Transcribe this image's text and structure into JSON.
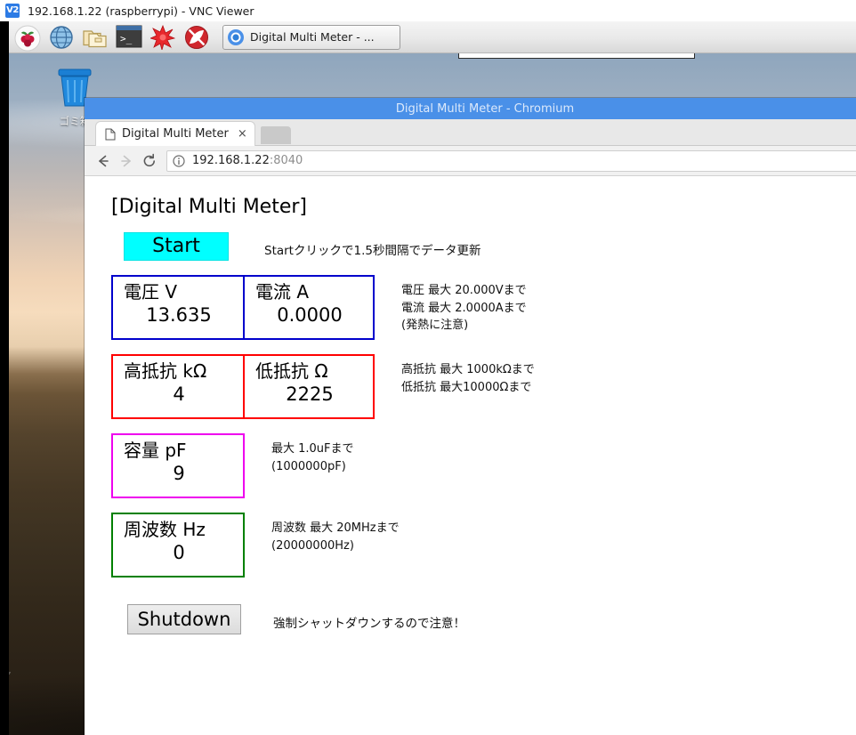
{
  "vnc": {
    "icon": "vnc-viewer-icon",
    "icon_text": "V2",
    "title": "192.168.1.22 (raspberrypi) - VNC Viewer"
  },
  "taskbar": {
    "icons": [
      {
        "name": "raspberry-menu-icon",
        "title": "Menu"
      },
      {
        "name": "globe-browser-icon",
        "title": "Web Browser"
      },
      {
        "name": "folder-file-manager-icon",
        "title": "File Manager"
      },
      {
        "name": "terminal-icon",
        "title": "Terminal"
      },
      {
        "name": "mathematica-star-icon",
        "title": "Mathematica"
      },
      {
        "name": "wolfram-icon",
        "title": "Wolfram"
      }
    ],
    "window_button_label": "Digital Multi Meter - ..."
  },
  "desktop": {
    "trash_label": "ゴミ箱"
  },
  "browser": {
    "window_title": "Digital Multi Meter - Chromium",
    "tab_title": "Digital Multi Meter",
    "tab_close": "×",
    "url_host": "192.168.1.22",
    "url_port": ":8040",
    "back_icon": "back-arrow-icon",
    "forward_icon": "forward-arrow-icon",
    "reload_icon": "reload-icon",
    "info_icon": "page-info-icon"
  },
  "app": {
    "title": "[Digital Multi Meter]",
    "start_button": "Start",
    "start_note": "Startクリックで1.5秒間隔でデータ更新",
    "shutdown_button": "Shutdown",
    "shutdown_note": "強制シャットダウンするので注意！",
    "groups": [
      {
        "id": "voltage-current",
        "color": "#0000cc",
        "cells": [
          {
            "id": "voltage",
            "label": "電圧 V",
            "value": "13.635"
          },
          {
            "id": "current",
            "label": "電流 A",
            "value": "0.0000"
          }
        ],
        "note": "電圧 最大 20.000Vまで\n電流 最大 2.0000Aまで\n(発熱に注意)"
      },
      {
        "id": "resistance",
        "color": "#ff0000",
        "cells": [
          {
            "id": "high-resistance",
            "label": "高抵抗 kΩ",
            "value": "4"
          },
          {
            "id": "low-resistance",
            "label": "低抵抗 Ω",
            "value": "2225"
          }
        ],
        "note": "高抵抗 最大 1000kΩまで\n低抵抗 最大10000Ωまで"
      },
      {
        "id": "capacitance",
        "color": "#ee00ee",
        "cells": [
          {
            "id": "capacitance",
            "label": "容量 pF",
            "value": "9"
          }
        ],
        "note": "最大 1.0uFまで\n(1000000pF)"
      },
      {
        "id": "frequency",
        "color": "#008000",
        "cells": [
          {
            "id": "frequency",
            "label": "周波数 Hz",
            "value": "0"
          }
        ],
        "note": "周波数 最大 20MHzまで\n(20000000Hz)"
      }
    ]
  }
}
